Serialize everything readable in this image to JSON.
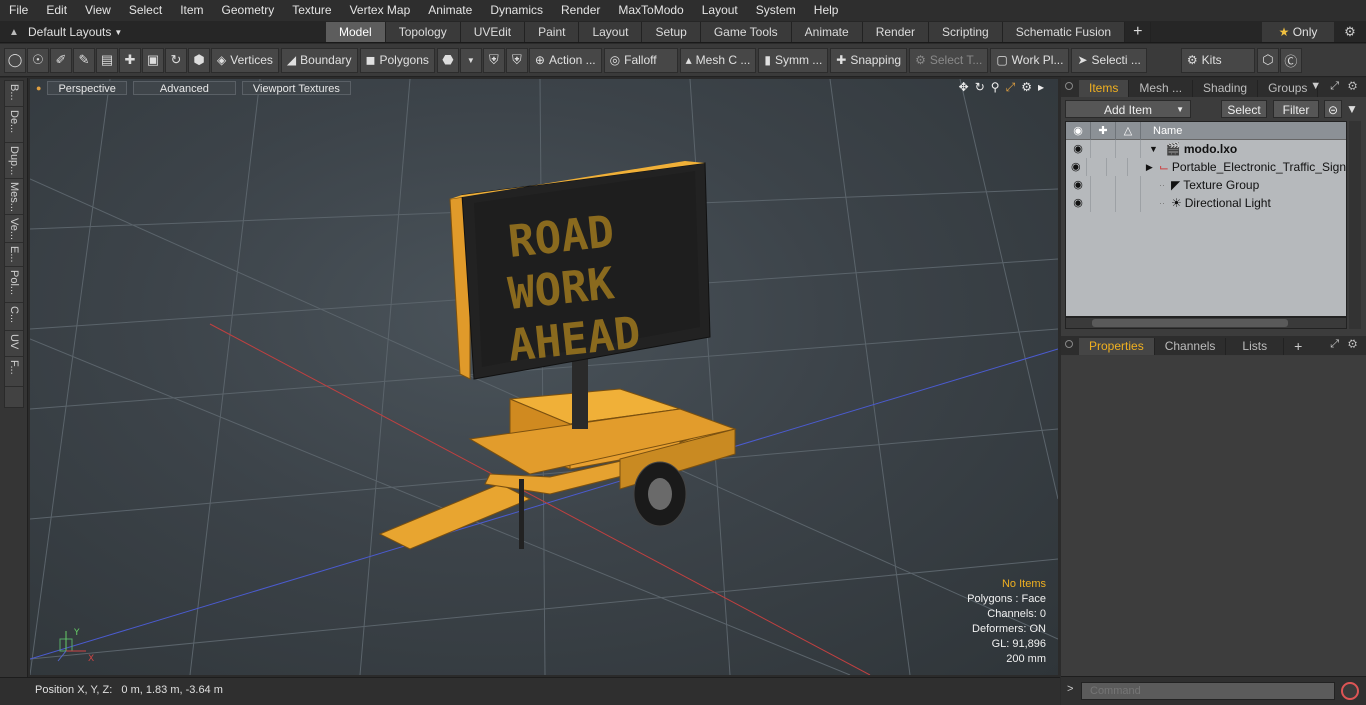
{
  "menubar": {
    "items": [
      "File",
      "Edit",
      "View",
      "Select",
      "Item",
      "Geometry",
      "Texture",
      "Vertex Map",
      "Animate",
      "Dynamics",
      "Render",
      "MaxToModo",
      "Layout",
      "System",
      "Help"
    ]
  },
  "layouts": {
    "label": "Default Layouts"
  },
  "tabs": [
    "Model",
    "Topology",
    "UVEdit",
    "Paint",
    "Layout",
    "Setup",
    "Game Tools",
    "Animate",
    "Render",
    "Scripting",
    "Schematic Fusion"
  ],
  "active_tab": "Model",
  "only_label": "Only",
  "toolbar": {
    "vertices": "Vertices",
    "boundary": "Boundary",
    "polygons": "Polygons",
    "action": "Action ...",
    "falloff": "Falloff",
    "mesh_c": "Mesh C ...",
    "symm": "Symm ...",
    "snapping": "Snapping",
    "select_t": "Select T...",
    "work_pl": "Work Pl...",
    "selecti": "Selecti ...",
    "kits": "Kits"
  },
  "left_tabs": [
    "B...",
    "De...",
    "Dup...",
    "Mes...",
    "Ve...",
    "E...",
    "Pol...",
    "C...",
    "UV",
    "F..."
  ],
  "viewport": {
    "perspective": "Perspective",
    "advanced": "Advanced",
    "textures": "Viewport Textures",
    "sign_text": [
      "ROAD",
      "WORK",
      "AHEAD"
    ],
    "stats": [
      "No Items",
      "Polygons : Face",
      "Channels: 0",
      "Deformers: ON",
      "GL: 91,896",
      "200 mm"
    ],
    "axis_y": "Y",
    "axis_x": "X"
  },
  "status": "Position X, Y, Z:   0 m, 1.83 m, -3.64 m",
  "items_panel": {
    "tabs": [
      "Items",
      "Mesh ...",
      "Shading",
      "Groups"
    ],
    "add_item": "Add Item",
    "select": "Select",
    "filter": "Filter",
    "name_col": "Name",
    "rows": [
      {
        "label": "modo.lxo"
      },
      {
        "label": "Portable_Electronic_Traffic_Sign"
      },
      {
        "label": "Texture Group"
      },
      {
        "label": "Directional Light"
      }
    ]
  },
  "props_panel": {
    "tabs": [
      "Properties",
      "Channels",
      "Lists"
    ]
  },
  "command": {
    "placeholder": "Command"
  },
  "colors": {
    "accent": "#f0b020",
    "sign": "#f0a830",
    "led": "#c89a28"
  }
}
